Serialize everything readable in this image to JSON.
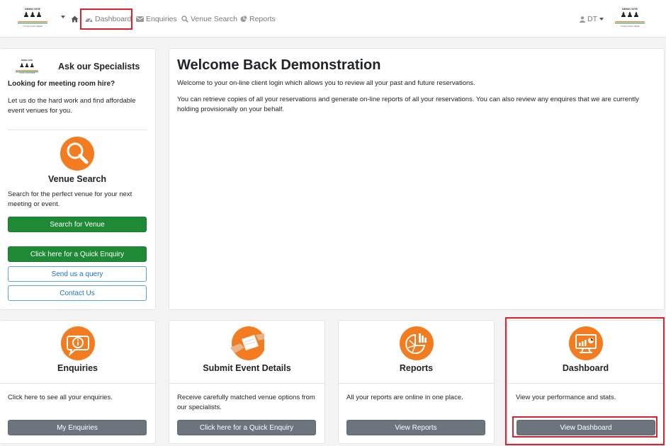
{
  "navbar": {
    "logo": {
      "title": "DEMO SITE",
      "tagline": "YOUR LOGO HERE"
    },
    "links": {
      "dashboard": "Dashboard",
      "enquiries": "Enquiries",
      "venue_search": "Venue Search",
      "reports": "Reports"
    },
    "user_initials": "DT"
  },
  "sidebar": {
    "title": "Ask our Specialists",
    "question": "Looking for meeting room hire?",
    "intro": "Let us do the hard work and find affordable event venues for you.",
    "venue_search": {
      "title": "Venue Search",
      "text": "Search for the perfect venue for your next meeting or event.",
      "button": "Search for Venue"
    },
    "quick_enquiry_button": "Click here for a Quick Enquiry",
    "query_button": "Send us a query",
    "contact_button": "Contact Us"
  },
  "welcome": {
    "title": "Welcome Back Demonstration",
    "p1": "Welcome to your on-line client login which allows you to review all your past and future reservations.",
    "p2": "You can retrieve copies of all your reservations and generate on-line reports of all your reservations. You can also review any enquires that we are currently holding provisionally on your behalf."
  },
  "cards": {
    "enquiries": {
      "title": "Enquiries",
      "text": "Click here to see all your enquiries.",
      "button": "My Enquiries"
    },
    "submit": {
      "title": "Submit Event Details",
      "text": "Receive carefully matched venue options from our specialists.",
      "button": "Click here for a Quick Enquiry"
    },
    "reports": {
      "title": "Reports",
      "text": "All your reports are online in one place.",
      "button": "View Reports"
    },
    "dashboard": {
      "title": "Dashboard",
      "text": "View your performance and stats.",
      "button": "View Dashboard"
    }
  },
  "colors": {
    "accent_orange": "#f47c20",
    "button_green": "#1f8a36",
    "button_gray": "#6c757d",
    "outline_blue": "#1a73c9",
    "highlight_red": "#d9232d"
  },
  "icons": {
    "nav": [
      "home-icon",
      "dashboard-gauge-icon",
      "envelope-icon",
      "search-icon",
      "pie-chart-icon",
      "user-icon"
    ],
    "cards": [
      "speech-bubble-info-icon",
      "handshake-document-icon",
      "pie-chart-icon",
      "monitor-chart-icon"
    ]
  }
}
